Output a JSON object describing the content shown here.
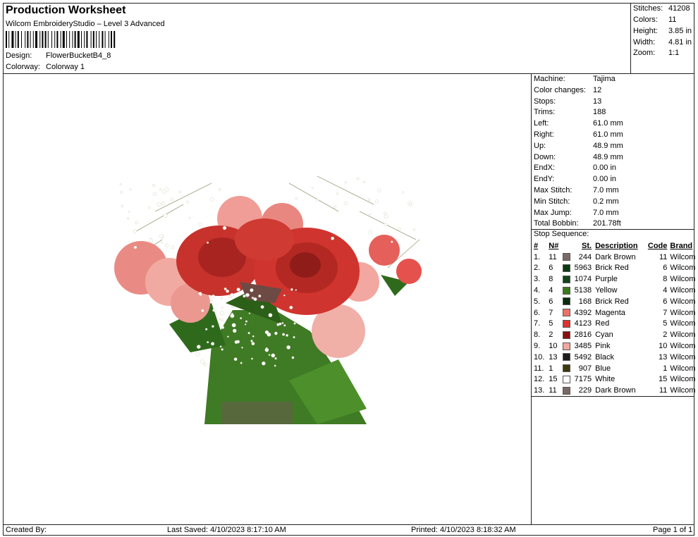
{
  "header": {
    "title": "Production Worksheet",
    "subtitle": "Wilcom EmbroideryStudio – Level 3 Advanced",
    "design_label": "Design:",
    "design_value": "FlowerBucketB4_8",
    "colorway_label": "Colorway:",
    "colorway_value": "Colorway 1"
  },
  "summary": {
    "stitches_label": "Stitches:",
    "stitches_value": "41208",
    "colors_label": "Colors:",
    "colors_value": "11",
    "height_label": "Height:",
    "height_value": "3.85 in",
    "width_label": "Width:",
    "width_value": "4.81 in",
    "zoom_label": "Zoom:",
    "zoom_value": "1:1"
  },
  "machine_info": [
    {
      "label": "Machine:",
      "value": "Tajima"
    },
    {
      "label": "Color changes:",
      "value": "12"
    },
    {
      "label": "Stops:",
      "value": "13"
    },
    {
      "label": "Trims:",
      "value": "188"
    },
    {
      "label": "Left:",
      "value": "61.0 mm"
    },
    {
      "label": "Right:",
      "value": "61.0 mm"
    },
    {
      "label": "Up:",
      "value": "48.9 mm"
    },
    {
      "label": "Down:",
      "value": "48.9 mm"
    },
    {
      "label": "EndX:",
      "value": "0.00 in"
    },
    {
      "label": "EndY:",
      "value": "0.00 in"
    },
    {
      "label": "Max Stitch:",
      "value": "7.0 mm"
    },
    {
      "label": "Min Stitch:",
      "value": "0.2 mm"
    },
    {
      "label": "Max Jump:",
      "value": "7.0 mm"
    },
    {
      "label": "Total Bobbin:",
      "value": "201.78ft"
    }
  ],
  "stop_sequence": {
    "title": "Stop Sequence:",
    "headers": {
      "idx": "#",
      "n": "N#",
      "st": "St.",
      "desc": "Description",
      "code": "Code",
      "brand": "Brand"
    },
    "rows": [
      {
        "idx": "1.",
        "n": "11",
        "color": "#7a6a66",
        "st": "244",
        "desc": "Dark Brown",
        "code": "11",
        "brand": "Wilcom"
      },
      {
        "idx": "2.",
        "n": "6",
        "color": "#0b3a12",
        "st": "5963",
        "desc": "Brick Red",
        "code": "6",
        "brand": "Wilcom"
      },
      {
        "idx": "3.",
        "n": "8",
        "color": "#12451b",
        "st": "1074",
        "desc": "Purple",
        "code": "8",
        "brand": "Wilcom"
      },
      {
        "idx": "4.",
        "n": "4",
        "color": "#3a7a1e",
        "st": "5138",
        "desc": "Yellow",
        "code": "4",
        "brand": "Wilcom"
      },
      {
        "idx": "5.",
        "n": "6",
        "color": "#0b2a0e",
        "st": "168",
        "desc": "Brick Red",
        "code": "6",
        "brand": "Wilcom"
      },
      {
        "idx": "6.",
        "n": "7",
        "color": "#f07066",
        "st": "4392",
        "desc": "Magenta",
        "code": "7",
        "brand": "Wilcom"
      },
      {
        "idx": "7.",
        "n": "5",
        "color": "#e03030",
        "st": "4123",
        "desc": "Red",
        "code": "5",
        "brand": "Wilcom"
      },
      {
        "idx": "8.",
        "n": "2",
        "color": "#8a1010",
        "st": "2816",
        "desc": "Cyan",
        "code": "2",
        "brand": "Wilcom"
      },
      {
        "idx": "9.",
        "n": "10",
        "color": "#f0a8a0",
        "st": "3485",
        "desc": "Pink",
        "code": "10",
        "brand": "Wilcom"
      },
      {
        "idx": "10.",
        "n": "13",
        "color": "#1c1c1c",
        "st": "5492",
        "desc": "Black",
        "code": "13",
        "brand": "Wilcom"
      },
      {
        "idx": "11.",
        "n": "1",
        "color": "#3a3a10",
        "st": "907",
        "desc": "Blue",
        "code": "1",
        "brand": "Wilcom"
      },
      {
        "idx": "12.",
        "n": "15",
        "color": "#ffffff",
        "st": "7175",
        "desc": "White",
        "code": "15",
        "brand": "Wilcom"
      },
      {
        "idx": "13.",
        "n": "11",
        "color": "#7a6a66",
        "st": "229",
        "desc": "Dark Brown",
        "code": "11",
        "brand": "Wilcom"
      }
    ]
  },
  "footer": {
    "created_by": "Created By:",
    "last_saved": "Last Saved: 4/10/2023 8:17:10 AM",
    "printed": "Printed: 4/10/2023 8:18:32 AM",
    "page": "Page 1 of 1"
  }
}
